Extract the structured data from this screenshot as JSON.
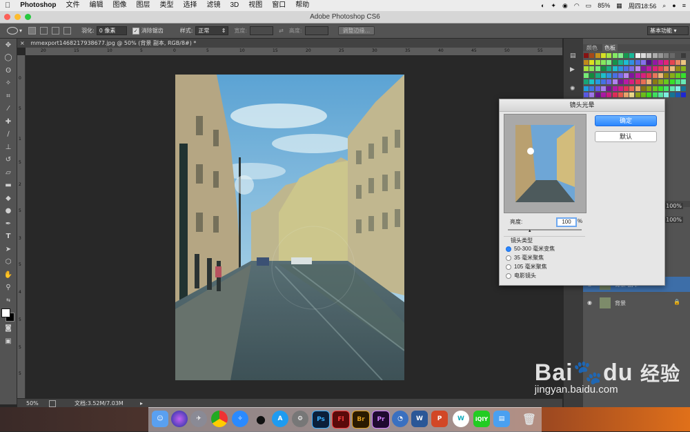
{
  "menubar": {
    "apple": "",
    "items": [
      "Photoshop",
      "文件",
      "编辑",
      "图像",
      "图层",
      "类型",
      "选择",
      "滤镜",
      "3D",
      "视图",
      "窗口",
      "帮助"
    ],
    "battery": "85%",
    "clock": "周四18:56"
  },
  "window": {
    "title": "Adobe Photoshop CS6"
  },
  "options": {
    "feather_label": "羽化:",
    "feather_value": "0 像素",
    "antialias_label": "消除锯齿",
    "style_label": "样式:",
    "style_value": "正常",
    "width_label": "宽度:",
    "height_label": "高度:",
    "refine_button": "调整边缘...",
    "workspace": "基本功能"
  },
  "document": {
    "tab": "mmexport1468217938677.jpg @ 50% (背景 副本, RGB/8#) *",
    "zoom": "50%",
    "doc_size": "文档:3.52M/7.03M",
    "ruler_top": [
      "20",
      "15",
      "10",
      "5",
      "0",
      "5",
      "10",
      "15",
      "20",
      "25",
      "30",
      "35",
      "40",
      "45",
      "50",
      "55"
    ],
    "ruler_left": [
      "0",
      "5",
      "1",
      "5",
      "2",
      "5",
      "3",
      "5",
      "4",
      "5",
      "5",
      "5"
    ]
  },
  "panels": {
    "tabs": [
      "颜色",
      "色板"
    ],
    "opacity": "100%",
    "fill": "100%",
    "layers": [
      {
        "name": "背景 副本",
        "visible": true
      },
      {
        "name": "背景",
        "visible": true
      }
    ]
  },
  "dialog": {
    "title": "镜头光晕",
    "ok": "确定",
    "default": "默认",
    "brightness_label": "亮度:",
    "brightness_value": "100",
    "percent": "%",
    "lens_type_label": "镜头类型",
    "lens_options": [
      "50-300 毫米变焦",
      "35 毫米聚焦",
      "105 毫米聚焦",
      "电影镜头"
    ],
    "selected_lens": "50-300 毫米变焦"
  },
  "dock": {
    "apps": [
      "finder-icon",
      "siri-icon",
      "launchpad-icon",
      "chrome-icon",
      "safari-icon",
      "qq-icon",
      "appstore-icon",
      "system-preferences-icon",
      "Ps",
      "Fl",
      "Br",
      "Pr",
      "browser-icon",
      "W",
      "P",
      "iqiyi-wlan-icon",
      "iQIY",
      "finder-folder-icon",
      "trash-icon"
    ]
  },
  "watermark": {
    "brand": "Bai",
    "brand2": "du",
    "cn": "经验",
    "url": "jingyan.baidu.com"
  },
  "colors": {
    "accent": "#2a86ff",
    "panel": "#535353",
    "bg": "#282828"
  }
}
